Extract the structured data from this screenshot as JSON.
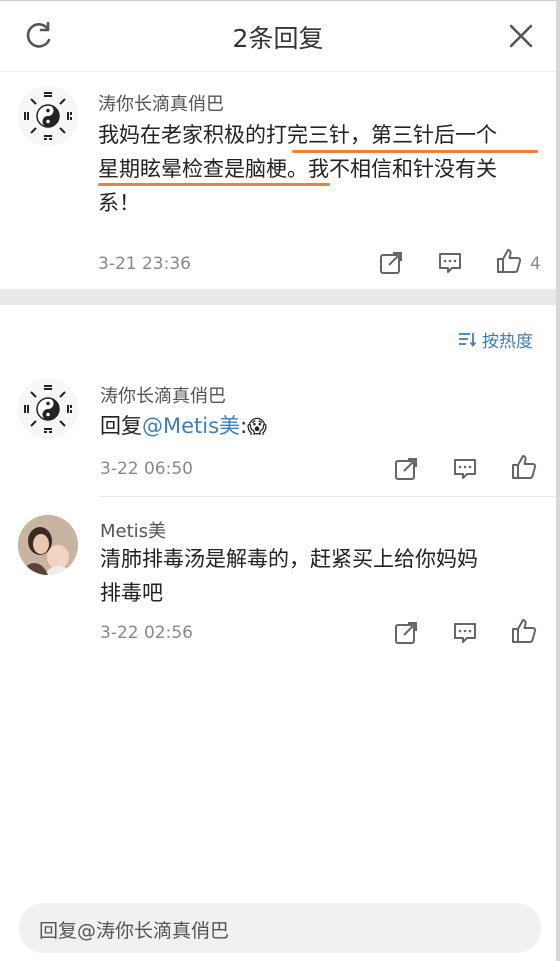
{
  "header": {
    "title": "2条回复"
  },
  "main_comment": {
    "username": "涛你长滴真俏巴",
    "text_line1": "我妈在老家积极的打完三针，第三针后一个",
    "text_line2": "星期眩晕检查是脑梗。我不相信和针没有关",
    "text_line3": "系！",
    "time": "3-21 23:36",
    "like_count": "4"
  },
  "sort": {
    "label": "按热度"
  },
  "replies": [
    {
      "username": "涛你长滴真俏巴",
      "prefix": "回复",
      "mention": "@Metis美",
      "suffix": ":",
      "emoji": "😱",
      "time": "3-22 06:50"
    },
    {
      "username": "Metis美",
      "text_line1": "清肺排毒汤是解毒的，赶紧买上给你妈妈",
      "text_line2": "排毒吧",
      "time": "3-22 02:56"
    }
  ],
  "reply_box": {
    "placeholder": "回复@涛你长滴真俏巴"
  },
  "colors": {
    "accent": "#3d7fb8",
    "underline": "#e8833c",
    "separator": "#e9e9e9"
  }
}
